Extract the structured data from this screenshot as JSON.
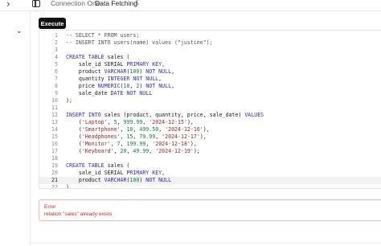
{
  "header": {
    "breadcrumb": [
      "Connection One",
      "Data Fetching"
    ],
    "chevron": "›",
    "theme_icon": "moon-icon",
    "left_icon": "chevron-right-icon",
    "panel_icon": "sidebar-panel-icon"
  },
  "sidebar": {
    "toggle_icon": "chevron-down-icon",
    "toggle_glyph": "⌄"
  },
  "toolbar": {
    "execute_label": "Execute"
  },
  "editor": {
    "current_line": 21,
    "lines": [
      {
        "n": "1",
        "tokens": [
          {
            "t": "-- SELECT * FROM users;",
            "c": "cmt"
          }
        ]
      },
      {
        "n": "2",
        "tokens": [
          {
            "t": "-- INSERT INTO users(name) values (\"justine\");",
            "c": "cmt"
          }
        ]
      },
      {
        "n": "3",
        "tokens": []
      },
      {
        "n": "4",
        "tokens": [
          {
            "t": "CREATE TABLE",
            "c": "kw"
          },
          {
            "t": " sales (",
            "c": "txt"
          }
        ]
      },
      {
        "n": "5",
        "tokens": [
          {
            "t": "    sale_id SERIAL ",
            "c": "txt"
          },
          {
            "t": "PRIMARY KEY",
            "c": "kw"
          },
          {
            "t": ",",
            "c": "txt"
          }
        ]
      },
      {
        "n": "6",
        "tokens": [
          {
            "t": "    product ",
            "c": "txt"
          },
          {
            "t": "VARCHAR",
            "c": "type"
          },
          {
            "t": "(",
            "c": "txt"
          },
          {
            "t": "100",
            "c": "num"
          },
          {
            "t": ") ",
            "c": "txt"
          },
          {
            "t": "NOT NULL",
            "c": "kw"
          },
          {
            "t": ",",
            "c": "txt"
          }
        ]
      },
      {
        "n": "7",
        "tokens": [
          {
            "t": "    quantity ",
            "c": "txt"
          },
          {
            "t": "INTEGER",
            "c": "type"
          },
          {
            "t": " ",
            "c": "txt"
          },
          {
            "t": "NOT NULL",
            "c": "kw"
          },
          {
            "t": ",",
            "c": "txt"
          }
        ]
      },
      {
        "n": "8",
        "tokens": [
          {
            "t": "    price ",
            "c": "txt"
          },
          {
            "t": "NUMERIC",
            "c": "type"
          },
          {
            "t": "(",
            "c": "txt"
          },
          {
            "t": "10",
            "c": "num"
          },
          {
            "t": ", ",
            "c": "txt"
          },
          {
            "t": "2",
            "c": "num"
          },
          {
            "t": ") ",
            "c": "txt"
          },
          {
            "t": "NOT NULL",
            "c": "kw"
          },
          {
            "t": ",",
            "c": "txt"
          }
        ]
      },
      {
        "n": "9",
        "tokens": [
          {
            "t": "    sale_date ",
            "c": "txt"
          },
          {
            "t": "DATE",
            "c": "type"
          },
          {
            "t": " ",
            "c": "txt"
          },
          {
            "t": "NOT NULL",
            "c": "kw"
          }
        ]
      },
      {
        "n": "10",
        "tokens": [
          {
            "t": ");",
            "c": "txt"
          }
        ]
      },
      {
        "n": "11",
        "tokens": []
      },
      {
        "n": "12",
        "tokens": [
          {
            "t": "INSERT INTO",
            "c": "kw"
          },
          {
            "t": " sales (product, quantity, price, sale_date) ",
            "c": "txt"
          },
          {
            "t": "VALUES",
            "c": "kw"
          }
        ]
      },
      {
        "n": "13",
        "tokens": [
          {
            "t": "    (",
            "c": "txt"
          },
          {
            "t": "'Laptop'",
            "c": "str"
          },
          {
            "t": ", ",
            "c": "txt"
          },
          {
            "t": "5",
            "c": "num"
          },
          {
            "t": ", ",
            "c": "txt"
          },
          {
            "t": "999.99",
            "c": "num"
          },
          {
            "t": ", ",
            "c": "txt"
          },
          {
            "t": "'2024-12-15'",
            "c": "str"
          },
          {
            "t": "),",
            "c": "txt"
          }
        ]
      },
      {
        "n": "14",
        "tokens": [
          {
            "t": "    (",
            "c": "txt"
          },
          {
            "t": "'Smartphone'",
            "c": "str"
          },
          {
            "t": ", ",
            "c": "txt"
          },
          {
            "t": "10",
            "c": "num"
          },
          {
            "t": ", ",
            "c": "txt"
          },
          {
            "t": "499.50",
            "c": "num"
          },
          {
            "t": ", ",
            "c": "txt"
          },
          {
            "t": "'2024-12-16'",
            "c": "str"
          },
          {
            "t": "),",
            "c": "txt"
          }
        ]
      },
      {
        "n": "15",
        "tokens": [
          {
            "t": "    (",
            "c": "txt"
          },
          {
            "t": "'Headphones'",
            "c": "str"
          },
          {
            "t": ", ",
            "c": "txt"
          },
          {
            "t": "15",
            "c": "num"
          },
          {
            "t": ", ",
            "c": "txt"
          },
          {
            "t": "79.99",
            "c": "num"
          },
          {
            "t": ", ",
            "c": "txt"
          },
          {
            "t": "'2024-12-17'",
            "c": "str"
          },
          {
            "t": "),",
            "c": "txt"
          }
        ]
      },
      {
        "n": "16",
        "tokens": [
          {
            "t": "    (",
            "c": "txt"
          },
          {
            "t": "'Monitor'",
            "c": "str"
          },
          {
            "t": ", ",
            "c": "txt"
          },
          {
            "t": "7",
            "c": "num"
          },
          {
            "t": ", ",
            "c": "txt"
          },
          {
            "t": "199.99",
            "c": "num"
          },
          {
            "t": ", ",
            "c": "txt"
          },
          {
            "t": "'2024-12-18'",
            "c": "str"
          },
          {
            "t": "),",
            "c": "txt"
          }
        ]
      },
      {
        "n": "17",
        "tokens": [
          {
            "t": "    (",
            "c": "txt"
          },
          {
            "t": "'Keyboard'",
            "c": "str"
          },
          {
            "t": ", ",
            "c": "txt"
          },
          {
            "t": "20",
            "c": "num"
          },
          {
            "t": ", ",
            "c": "txt"
          },
          {
            "t": "49.99",
            "c": "num"
          },
          {
            "t": ", ",
            "c": "txt"
          },
          {
            "t": "'2024-12-19'",
            "c": "str"
          },
          {
            "t": ");",
            "c": "txt"
          }
        ]
      },
      {
        "n": "18",
        "tokens": []
      },
      {
        "n": "19",
        "tokens": [
          {
            "t": "CREATE TABLE",
            "c": "kw"
          },
          {
            "t": " sales (",
            "c": "txt"
          }
        ]
      },
      {
        "n": "20",
        "tokens": [
          {
            "t": "    sale_id SERIAL ",
            "c": "txt"
          },
          {
            "t": "PRIMARY KEY",
            "c": "kw"
          },
          {
            "t": ",",
            "c": "txt"
          }
        ]
      },
      {
        "n": "21",
        "tokens": [
          {
            "t": "    product ",
            "c": "txt"
          },
          {
            "t": "VARCHAR",
            "c": "type"
          },
          {
            "t": "(",
            "c": "txt"
          },
          {
            "t": "100",
            "c": "num"
          },
          {
            "t": ") ",
            "c": "txt"
          },
          {
            "t": "NOT NULL",
            "c": "kw"
          }
        ]
      },
      {
        "n": "22",
        "tokens": [
          {
            "t": ")",
            "c": "txt"
          }
        ]
      }
    ]
  },
  "error": {
    "title": "Error",
    "message": "relation \"sales\" already exists"
  },
  "colors": {
    "execute_bg": "#111111",
    "error_text": "#c62828",
    "error_border": "#f0b6b6",
    "keyword": "#2b2bb8",
    "string": "#a32222",
    "number": "#0f7d3f"
  }
}
